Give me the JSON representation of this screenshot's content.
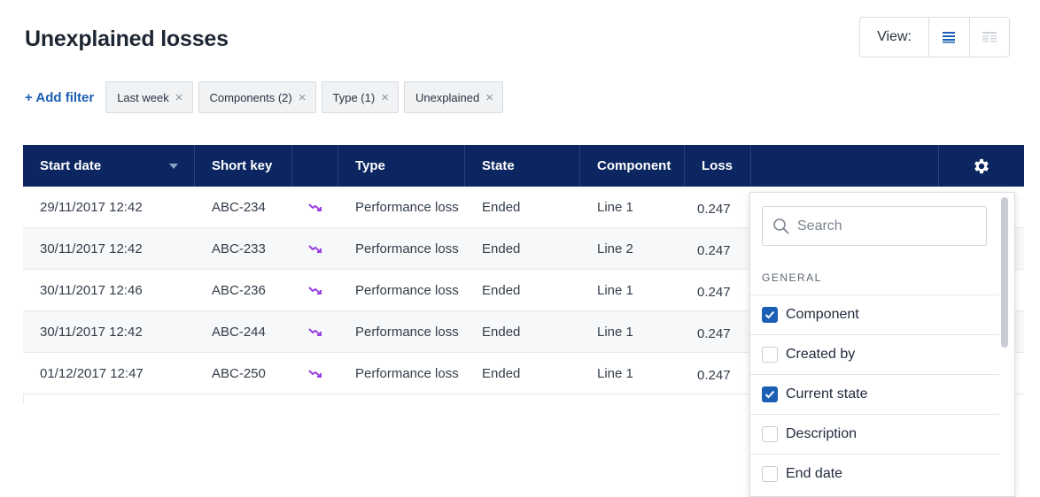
{
  "page": {
    "title": "Unexplained losses"
  },
  "view": {
    "label": "View:",
    "options": [
      "list-view-icon",
      "grid-view-icon"
    ],
    "active": "list-view-icon"
  },
  "filters": {
    "add_label": "+ Add filter",
    "chips": [
      {
        "label": "Last week"
      },
      {
        "label": "Components (2)"
      },
      {
        "label": "Type (1)"
      },
      {
        "label": "Unexplained"
      }
    ]
  },
  "table": {
    "headers": {
      "start_date": "Start date",
      "short_key": "Short key",
      "trend": "",
      "type": "Type",
      "state": "State",
      "component": "Component",
      "loss": "Loss",
      "extra": ""
    },
    "rows": [
      {
        "start_date": "29/11/2017 12:42",
        "short_key": "ABC-234",
        "type": "Performance loss",
        "state": "Ended",
        "component": "Line 1",
        "loss": "0.247"
      },
      {
        "start_date": "30/11/2017 12:42",
        "short_key": "ABC-233",
        "type": "Performance loss",
        "state": "Ended",
        "component": "Line 2",
        "loss": "0.247"
      },
      {
        "start_date": "30/11/2017 12:46",
        "short_key": "ABC-236",
        "type": "Performance loss",
        "state": "Ended",
        "component": "Line 1",
        "loss": "0.247"
      },
      {
        "start_date": "30/11/2017 12:42",
        "short_key": "ABC-244",
        "type": "Performance loss",
        "state": "Ended",
        "component": "Line 1",
        "loss": "0.247"
      },
      {
        "start_date": "01/12/2017 12:47",
        "short_key": "ABC-250",
        "type": "Performance loss",
        "state": "Ended",
        "component": "Line 1",
        "loss": "0.247"
      }
    ]
  },
  "column_picker": {
    "search_placeholder": "Search",
    "section": "GENERAL",
    "items": [
      {
        "label": "Component",
        "checked": true
      },
      {
        "label": "Created by",
        "checked": false
      },
      {
        "label": "Current state",
        "checked": true
      },
      {
        "label": "Description",
        "checked": false
      },
      {
        "label": "End date",
        "checked": false
      }
    ]
  },
  "colors": {
    "header_bg": "#0b2660",
    "accent": "#1a5fb4",
    "trend": "#9b3fe0"
  }
}
